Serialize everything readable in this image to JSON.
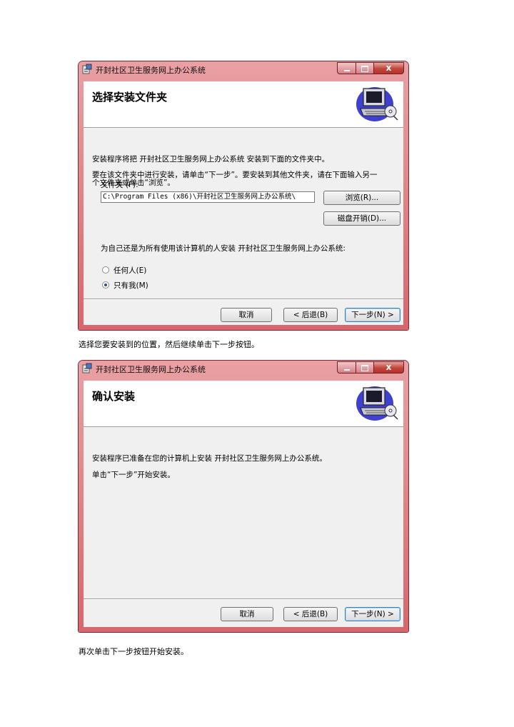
{
  "dialog1": {
    "window_title": "开封社区卫生服务网上办公系统",
    "close_glyph": "x",
    "header_title": "选择安装文件夹",
    "intro_line": "安装程序将把 开封社区卫生服务网上办公系统 安装到下面的文件夹中。",
    "instructions_line1": "要在该文件夹中进行安装，请单击“下一步”。要安装到其他文件夹，请在下面输入另一",
    "instructions_line2": "个文件夹或单击“浏览”。",
    "folder_label": "文件夹 (F):",
    "folder_value": "C:\\Program Files (x86)\\开封社区卫生服务网上办公系统\\",
    "browse_button": "浏览(R)...",
    "disk_cost_button": "磁盘开销(D)...",
    "install_for_label": "为自己还是为所有使用该计算机的人安装 开封社区卫生服务网上办公系统:",
    "option_everyone": "任何人(E)",
    "option_just_me": "只有我(M)",
    "selected_option": "just_me",
    "cancel_button": "取消",
    "back_button": "< 后退(B)",
    "next_button": "下一步(N) >"
  },
  "caption1": "选择您要安装到的位置，然后继续单击下一步按钮。",
  "dialog2": {
    "window_title": "开封社区卫生服务网上办公系统",
    "close_glyph": "x",
    "header_title": "确认安装",
    "ready_line": "安装程序已准备在您的计算机上安装 开封社区卫生服务网上办公系统。",
    "click_next_line": "单击“下一步”开始安装。",
    "cancel_button": "取消",
    "back_button": "< 后退(B)",
    "next_button": "下一步(N) >"
  },
  "caption2": "再次单击下一步按钮开始安装。",
  "colors": {
    "frame": "#d8666c",
    "client": "#f0f0f0",
    "default_button_border": "#3c7fb1"
  },
  "icons": [
    "installer-icon",
    "minimize-icon",
    "maximize-icon",
    "close-icon",
    "computer-cd-icon"
  ]
}
